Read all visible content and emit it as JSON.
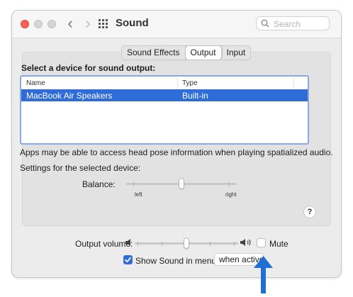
{
  "window": {
    "title": "Sound",
    "search_placeholder": "Search"
  },
  "tabs": [
    {
      "label": "Sound Effects",
      "active": false
    },
    {
      "label": "Output",
      "active": true
    },
    {
      "label": "Input",
      "active": false
    }
  ],
  "output": {
    "select_label": "Select a device for sound output:",
    "columns": {
      "name": "Name",
      "type": "Type"
    },
    "devices": [
      {
        "name": "MacBook Air Speakers",
        "type": "Built-in",
        "selected": true
      }
    ],
    "info": "Apps may be able to access head pose information when playing spatialized audio.",
    "settings_label": "Settings for the selected device:",
    "balance_label": "Balance:",
    "balance_left": "left",
    "balance_right": "right",
    "balance_value": 0.5,
    "help": "?"
  },
  "footer": {
    "volume_label": "Output volume:",
    "volume_value": 0.5,
    "mute_label": "Mute",
    "mute_checked": false,
    "show_label": "Show Sound in menu bar",
    "show_checked": true,
    "show_popup_value": "when active"
  },
  "colors": {
    "accent": "#2f6cd8",
    "annotation_arrow": "#1f6fd4"
  },
  "icons": {
    "speaker_low": "speaker-low-icon",
    "speaker_high": "speaker-high-icon",
    "search": "search-icon",
    "grid": "grid-icon"
  }
}
